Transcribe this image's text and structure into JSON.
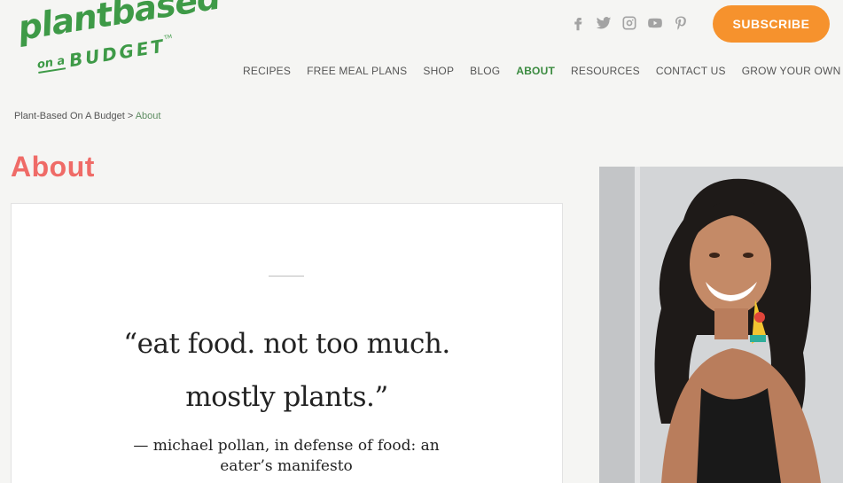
{
  "brand": {
    "logo_line1": "plantbased",
    "logo_on_a": "on a",
    "logo_budget": "BUDGET",
    "logo_tm": "TM",
    "green": "#3e9a47"
  },
  "social": [
    "facebook-icon",
    "twitter-icon",
    "instagram-icon",
    "youtube-icon",
    "pinterest-icon"
  ],
  "header": {
    "subscribe_label": "SUBSCRIBE",
    "subscribe_color": "#f6922d"
  },
  "nav": {
    "items": [
      {
        "label": "RECIPES"
      },
      {
        "label": "FREE MEAL PLANS"
      },
      {
        "label": "SHOP"
      },
      {
        "label": "BLOG"
      },
      {
        "label": "ABOUT"
      },
      {
        "label": "RESOURCES"
      },
      {
        "label": "CONTACT US"
      },
      {
        "label": "GROW YOUR OWN"
      }
    ],
    "active": "ABOUT"
  },
  "breadcrumb": {
    "home": "Plant-Based On A Budget",
    "separator": ">",
    "current": "About"
  },
  "page": {
    "title": "About",
    "title_color": "#ef6b67"
  },
  "quote": {
    "line1": "“eat food. not too much.",
    "line2": "mostly plants.”",
    "attribution_line1": "— michael pollan, in defense of food: an",
    "attribution_line2": "eater’s manifesto"
  }
}
